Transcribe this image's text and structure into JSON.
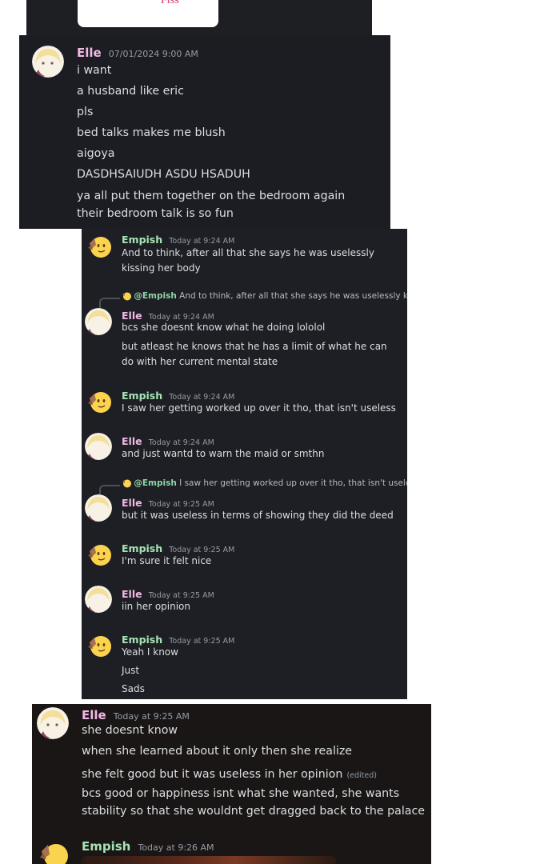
{
  "colors": {
    "elle_name": "#f2b8e6",
    "empish_name": "#a6e3b4",
    "panel_a": "#1c1d23",
    "panel_b": "#1e1f24",
    "panel_c": "#1a1616"
  },
  "top_card": {
    "text": "Fiss"
  },
  "panel_a": {
    "author": "Elle",
    "timestamp": "07/01/2024 9:00 AM",
    "lines": [
      "i want",
      "a husband like eric",
      "pls",
      "bed talks makes me blush",
      "aigoya",
      "DASDHSAIUDH ASDU HSADUH",
      "ya all put them together on the bedroom again their bedroom talk is so fun"
    ]
  },
  "panel_b": {
    "messages": [
      {
        "author": "Empish",
        "timestamp": "Today at 9:24 AM",
        "lines": [
          "And to think, after all that she says he was uselessly kissing her body"
        ]
      },
      {
        "author": "Elle",
        "timestamp": "Today at 9:24 AM",
        "reply_to": "@Empish",
        "reply_text": "And to think, after all that she says he was uselessly ki...",
        "lines": [
          "bcs she doesnt know what he doing lololol",
          "but atleast he knows that he has a limit of what he can do with her current mental state"
        ]
      },
      {
        "author": "Empish",
        "timestamp": "Today at 9:24 AM",
        "lines": [
          "I saw her getting worked up over it tho, that isn't useless"
        ]
      },
      {
        "author": "Elle",
        "timestamp": "Today at 9:24 AM",
        "lines": [
          "and just wantd to warn the maid or smthn"
        ]
      },
      {
        "author": "Elle",
        "timestamp": "Today at 9:25 AM",
        "reply_to": "@Empish",
        "reply_text": "I saw her getting worked up over it tho, that isn't useless",
        "lines": [
          "but it was useless in terms of showing they did the deed"
        ]
      },
      {
        "author": "Empish",
        "timestamp": "Today at 9:25 AM",
        "lines": [
          "I'm sure it felt nice"
        ]
      },
      {
        "author": "Elle",
        "timestamp": "Today at 9:25 AM",
        "lines": [
          "iin her opinion"
        ]
      },
      {
        "author": "Empish",
        "timestamp": "Today at 9:25 AM",
        "lines": [
          "Yeah I know",
          "Just",
          "Sads"
        ]
      }
    ]
  },
  "panel_c": {
    "author": "Elle",
    "timestamp": "Today at 9:25 AM",
    "lines": [
      "she doesnt know",
      "when she learned about it only then she realize",
      "she felt good but it was useless in her opinion",
      "bcs good or happiness isnt what she wanted, she wants stability so that she wouldnt get dragged back to the palace"
    ],
    "edited_label": "(edited)",
    "next_author": "Empish",
    "next_timestamp": "Today at 9:26 AM"
  }
}
